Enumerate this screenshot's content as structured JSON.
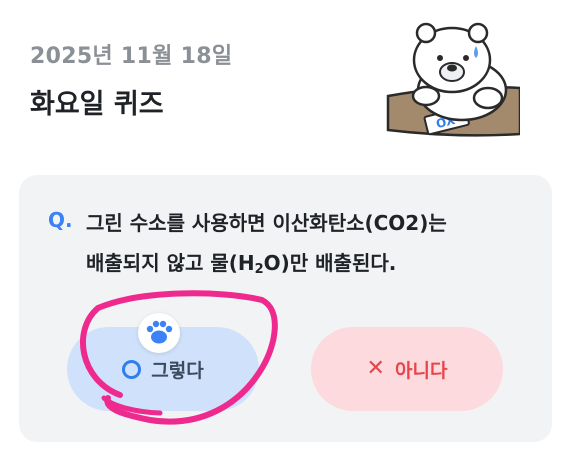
{
  "header": {
    "date": "2025년 11월 18일",
    "title": "화요일 퀴즈"
  },
  "quiz": {
    "q_mark": "Q.",
    "question_line1": "그린 수소를 사용하면 이산화탄소(CO2)는",
    "question_line2_prefix": "배출되지 않고 물(H",
    "question_line2_sub": "2",
    "question_line2_suffix": "O)만 배출된다.",
    "answer_yes": "그렇다",
    "answer_no": "아니다"
  },
  "icons": {
    "yes": "o-circle-icon",
    "no": "x-icon",
    "paw": "paw-icon"
  },
  "mascot_card_text": "OX",
  "colors": {
    "accent_blue": "#3b82f6",
    "yes_bg": "#cfe1fb",
    "no_bg": "#fcdadd",
    "no_red": "#e6454b",
    "highlight_pink": "#ee2a8f"
  }
}
